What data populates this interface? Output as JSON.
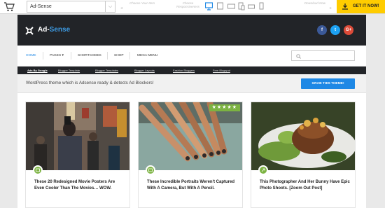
{
  "topbar": {
    "theme_name": "Ad-Sense",
    "hint_choose_theme": "Choose Your Item",
    "hint_choose_responsive": "Choose Responsiveness",
    "hint_download": "Download Now",
    "get_it_label": "GET IT NOW!"
  },
  "site": {
    "logo_prefix": "Ad-",
    "logo_accent": "Sense",
    "social": [
      "f",
      "t",
      "G+"
    ],
    "nav": [
      "HOME",
      "PAGES",
      "SHORTCODES",
      "SHOP",
      "MEGA MENU"
    ],
    "subnav": [
      "Ads By Google",
      "Blogger Template",
      "Blogger Templates",
      "Blogger Layouts",
      "Fashion Bloggers",
      "Free Blogspot"
    ],
    "promo_text": "WordPress theme which is Adsense ready & detects Ad Blockers!",
    "grab_label": "GRAB THIS THEME!",
    "stars": "★★★★★",
    "cards": [
      {
        "title": "These 20 Redesigned Movie Posters Are Even Cooler Than The Movies… WOW."
      },
      {
        "title": "These Incredible Portraits Weren't Captured With A Camera, But With A Pencil."
      },
      {
        "title": "This Photographer And Her Bunny Have Epic Photo Shoots. [Zoom Out Post]"
      }
    ]
  },
  "colors": {
    "accent": "#3d9be3",
    "header_bg": "#222428",
    "cta_yellow": "#ffcc00",
    "badge_green": "#7cb342",
    "grab_blue": "#1e88e5"
  }
}
